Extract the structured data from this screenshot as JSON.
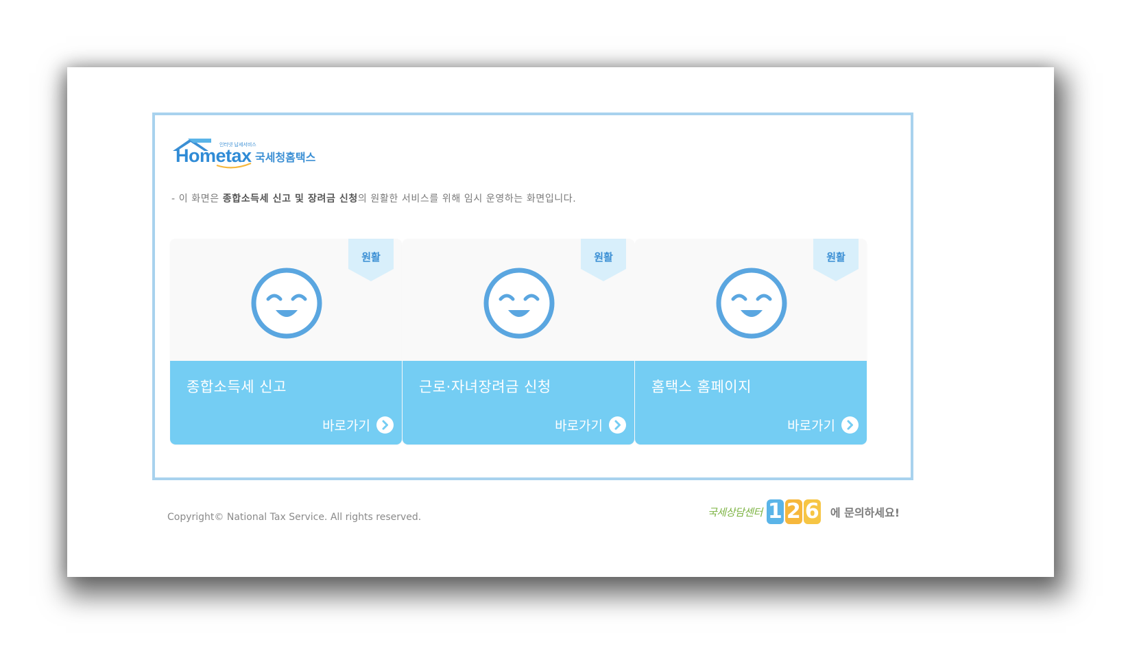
{
  "logo": {
    "brand_text": "Hometax",
    "korean_name": "국세청홈택스",
    "tagline": "인터넷 납세서비스"
  },
  "notice": {
    "prefix": "- 이 화면은 ",
    "highlight": "종합소득세 신고 및 장려금 신청",
    "suffix": "의 원활한 서비스를 위해 임시 운영하는 화면입니다."
  },
  "cards": [
    {
      "status": "원활",
      "title": "종합소득세 신고",
      "link_label": "바로가기",
      "status_icon": "smiley-face-icon"
    },
    {
      "status": "원활",
      "title": "근로·자녀장려금 신청",
      "link_label": "바로가기",
      "status_icon": "smiley-face-icon"
    },
    {
      "status": "원활",
      "title": "홈택스 홈페이지",
      "link_label": "바로가기",
      "status_icon": "smiley-face-icon"
    }
  ],
  "footer": {
    "copyright": "Copyright© National Tax Service. All rights reserved.",
    "center_prefix": "국세상담센터",
    "center_number": [
      "1",
      "2",
      "6"
    ],
    "center_suffix": "에 문의하세요!"
  },
  "colors": {
    "frame_border": "#a8d2ee",
    "card_accent": "#74cdf3",
    "status_blue": "#3b8fd4",
    "smiley_blue": "#5aa6e0"
  }
}
